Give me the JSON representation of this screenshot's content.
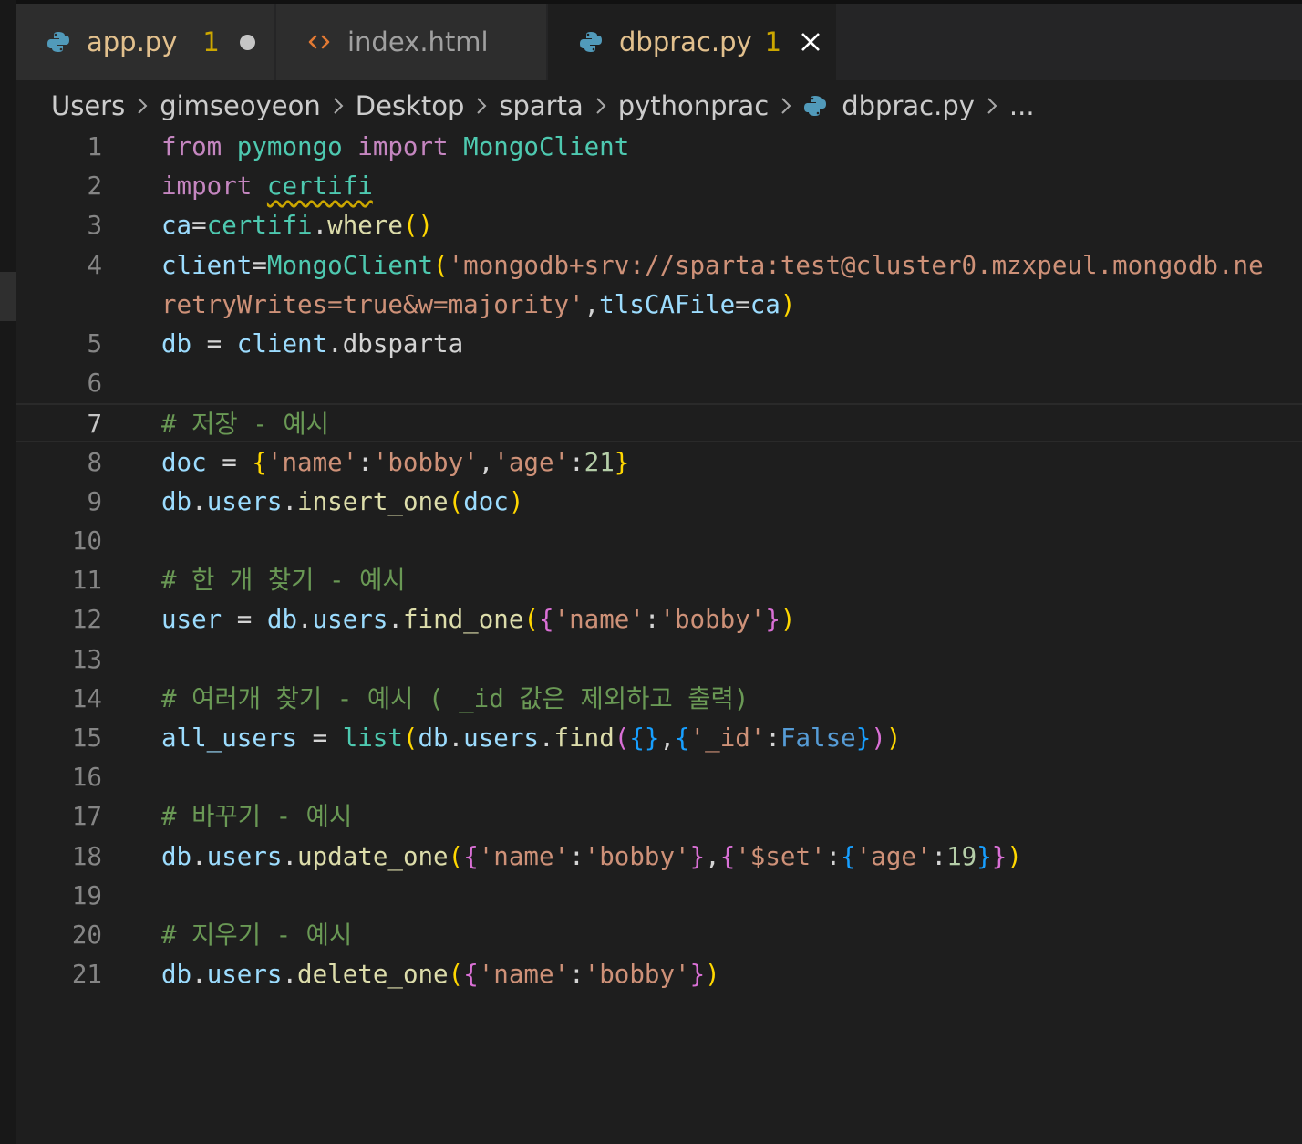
{
  "tabs": [
    {
      "label": "app.py",
      "badge": "1",
      "icon": "python-icon",
      "modified": true,
      "color": "#e2c08d"
    },
    {
      "label": "index.html",
      "badge": "",
      "icon": "html-icon",
      "modified": false,
      "color": "#a0a0a0"
    },
    {
      "label": "dbprac.py",
      "badge": "1",
      "icon": "python-icon",
      "active": true,
      "color": "#e2c08d"
    }
  ],
  "breadcrumb": [
    "Users",
    "gimseoyeon",
    "Desktop",
    "sparta",
    "pythonprac",
    "dbprac.py",
    "..."
  ],
  "colors": {
    "keyword": "#c586c0",
    "module": "#4ec9b0",
    "variable": "#9cdcfe",
    "function": "#dcdcaa",
    "string": "#ce9178",
    "number": "#b5cea8",
    "comment": "#6a9955",
    "plain": "#d4d4d4",
    "constant": "#569cd6",
    "bracket1": "#ffd700",
    "bracket2": "#da70d6",
    "bracket3": "#179fff"
  },
  "editor": {
    "current_line": 7,
    "lines": [
      {
        "n": "1",
        "tokens": [
          [
            "from",
            "keyword"
          ],
          [
            " ",
            "plain"
          ],
          [
            "pymongo",
            "module"
          ],
          [
            " ",
            "plain"
          ],
          [
            "import",
            "keyword"
          ],
          [
            " ",
            "plain"
          ],
          [
            "MongoClient",
            "module"
          ]
        ]
      },
      {
        "n": "2",
        "tokens": [
          [
            "import",
            "keyword"
          ],
          [
            " ",
            "plain"
          ],
          [
            "certifi",
            "module",
            "squiggle"
          ]
        ]
      },
      {
        "n": "3",
        "tokens": [
          [
            "ca",
            "variable"
          ],
          [
            "=",
            "plain"
          ],
          [
            "certifi",
            "module"
          ],
          [
            ".",
            "plain"
          ],
          [
            "where",
            "function"
          ],
          [
            "()",
            "bracket1"
          ]
        ]
      },
      {
        "n": "4",
        "tokens": [
          [
            "client",
            "variable"
          ],
          [
            "=",
            "plain"
          ],
          [
            "MongoClient",
            "module"
          ],
          [
            "(",
            "bracket1"
          ],
          [
            "'mongodb+srv://sparta:test@cluster0.mzxpeul.mongodb.ne",
            "string"
          ]
        ]
      },
      {
        "n": "",
        "tokens": [
          [
            "retryWrites=true&w=majority'",
            "string"
          ],
          [
            ",",
            "plain"
          ],
          [
            "tlsCAFile",
            "variable"
          ],
          [
            "=",
            "plain"
          ],
          [
            "ca",
            "variable"
          ],
          [
            ")",
            "bracket1"
          ]
        ]
      },
      {
        "n": "5",
        "tokens": [
          [
            "db",
            "variable"
          ],
          [
            " = ",
            "plain"
          ],
          [
            "client",
            "variable"
          ],
          [
            ".",
            "plain"
          ],
          [
            "dbsparta",
            "plain"
          ]
        ]
      },
      {
        "n": "6",
        "tokens": []
      },
      {
        "n": "7",
        "tokens": [
          [
            "# 저장 - 예시",
            "comment"
          ]
        ]
      },
      {
        "n": "8",
        "tokens": [
          [
            "doc",
            "variable"
          ],
          [
            " = ",
            "plain"
          ],
          [
            "{",
            "bracket1"
          ],
          [
            "'name'",
            "string"
          ],
          [
            ":",
            "plain"
          ],
          [
            "'bobby'",
            "string"
          ],
          [
            ",",
            "plain"
          ],
          [
            "'age'",
            "string"
          ],
          [
            ":",
            "plain"
          ],
          [
            "21",
            "number"
          ],
          [
            "}",
            "bracket1"
          ]
        ]
      },
      {
        "n": "9",
        "tokens": [
          [
            "db",
            "variable"
          ],
          [
            ".",
            "plain"
          ],
          [
            "users",
            "variable"
          ],
          [
            ".",
            "plain"
          ],
          [
            "insert_one",
            "function"
          ],
          [
            "(",
            "bracket1"
          ],
          [
            "doc",
            "variable"
          ],
          [
            ")",
            "bracket1"
          ]
        ]
      },
      {
        "n": "10",
        "tokens": []
      },
      {
        "n": "11",
        "tokens": [
          [
            "# 한 개 찾기 - 예시",
            "comment"
          ]
        ]
      },
      {
        "n": "12",
        "tokens": [
          [
            "user",
            "variable"
          ],
          [
            " = ",
            "plain"
          ],
          [
            "db",
            "variable"
          ],
          [
            ".",
            "plain"
          ],
          [
            "users",
            "variable"
          ],
          [
            ".",
            "plain"
          ],
          [
            "find_one",
            "function"
          ],
          [
            "(",
            "bracket1"
          ],
          [
            "{",
            "bracket2"
          ],
          [
            "'name'",
            "string"
          ],
          [
            ":",
            "plain"
          ],
          [
            "'bobby'",
            "string"
          ],
          [
            "}",
            "bracket2"
          ],
          [
            ")",
            "bracket1"
          ]
        ]
      },
      {
        "n": "13",
        "tokens": []
      },
      {
        "n": "14",
        "tokens": [
          [
            "# 여러개 찾기 - 예시 ( _id 값은 제외하고 출력)",
            "comment"
          ]
        ]
      },
      {
        "n": "15",
        "tokens": [
          [
            "all_users",
            "variable"
          ],
          [
            " = ",
            "plain"
          ],
          [
            "list",
            "module"
          ],
          [
            "(",
            "bracket1"
          ],
          [
            "db",
            "variable"
          ],
          [
            ".",
            "plain"
          ],
          [
            "users",
            "variable"
          ],
          [
            ".",
            "plain"
          ],
          [
            "find",
            "function"
          ],
          [
            "(",
            "bracket2"
          ],
          [
            "{}",
            "bracket3"
          ],
          [
            ",",
            "plain"
          ],
          [
            "{",
            "bracket3"
          ],
          [
            "'_id'",
            "string"
          ],
          [
            ":",
            "plain"
          ],
          [
            "False",
            "constant"
          ],
          [
            "}",
            "bracket3"
          ],
          [
            ")",
            "bracket2"
          ],
          [
            ")",
            "bracket1"
          ]
        ]
      },
      {
        "n": "16",
        "tokens": []
      },
      {
        "n": "17",
        "tokens": [
          [
            "# 바꾸기 - 예시",
            "comment"
          ]
        ]
      },
      {
        "n": "18",
        "tokens": [
          [
            "db",
            "variable"
          ],
          [
            ".",
            "plain"
          ],
          [
            "users",
            "variable"
          ],
          [
            ".",
            "plain"
          ],
          [
            "update_one",
            "function"
          ],
          [
            "(",
            "bracket1"
          ],
          [
            "{",
            "bracket2"
          ],
          [
            "'name'",
            "string"
          ],
          [
            ":",
            "plain"
          ],
          [
            "'bobby'",
            "string"
          ],
          [
            "}",
            "bracket2"
          ],
          [
            ",",
            "plain"
          ],
          [
            "{",
            "bracket2"
          ],
          [
            "'$set'",
            "string"
          ],
          [
            ":",
            "plain"
          ],
          [
            "{",
            "bracket3"
          ],
          [
            "'age'",
            "string"
          ],
          [
            ":",
            "plain"
          ],
          [
            "19",
            "number"
          ],
          [
            "}",
            "bracket3"
          ],
          [
            "}",
            "bracket2"
          ],
          [
            ")",
            "bracket1"
          ]
        ]
      },
      {
        "n": "19",
        "tokens": []
      },
      {
        "n": "20",
        "tokens": [
          [
            "# 지우기 - 예시",
            "comment"
          ]
        ]
      },
      {
        "n": "21",
        "tokens": [
          [
            "db",
            "variable"
          ],
          [
            ".",
            "plain"
          ],
          [
            "users",
            "variable"
          ],
          [
            ".",
            "plain"
          ],
          [
            "delete_one",
            "function"
          ],
          [
            "(",
            "bracket1"
          ],
          [
            "{",
            "bracket2"
          ],
          [
            "'name'",
            "string"
          ],
          [
            ":",
            "plain"
          ],
          [
            "'bobby'",
            "string"
          ],
          [
            "}",
            "bracket2"
          ],
          [
            ")",
            "bracket1"
          ]
        ]
      }
    ]
  }
}
